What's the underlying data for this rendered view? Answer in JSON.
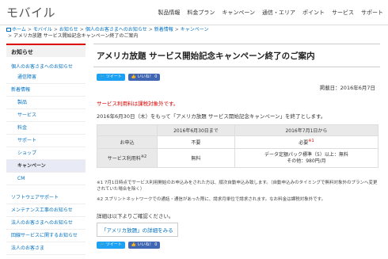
{
  "header": {
    "logo": "モバイル",
    "nav": [
      "製品情報",
      "料金プラン",
      "キャンペーン",
      "通信・エリア",
      "ポイント",
      "サービス",
      "サポート"
    ]
  },
  "breadcrumb": {
    "items": [
      "ホーム",
      "モバイル",
      "お知らせ",
      "個人のお客さまへのお知らせ",
      "新着情報",
      "キャンペーン"
    ],
    "current": "アメリカ放題 サービス開始記念キャンペーン終了のご案内"
  },
  "sidebar": {
    "heading": "お知らせ",
    "group": "個人のお客さまへのお知らせ",
    "items": [
      "通信障害",
      "新着情報",
      "製品",
      "サービス",
      "料金",
      "サポート",
      "ショップ",
      "キャンペーン",
      "CM"
    ],
    "bottom_links": [
      "ソフトウェアサポート",
      "メンテナンス工事のお知らせ",
      "法人のお客さまへのお知らせ",
      "回線サービスに関するお知らせ",
      "法人のお客さま"
    ]
  },
  "article": {
    "title": "アメリカ放題 サービス開始記念キャンペーン終了のご案内",
    "tweet_label": "ツイート",
    "like_label": "いいね！ 0",
    "pubdate": "掲載日：2016年6月7日",
    "notice_red": "サービス利用料は課税対象外です。",
    "lead": "2016年6月30日（木）をもって「アメリカ放題 サービス開始記念キャンペーン」を終了とします。",
    "table": {
      "headers": [
        "2016年6月30日まで",
        "2016年7月1日から"
      ],
      "rows": [
        {
          "label": "お申込",
          "before": "不要",
          "after": "必要"
        },
        {
          "label": "サービス利用料",
          "before": "無料",
          "after": "データ定額パック標準（5）以上：無料\nその他：980円/月"
        }
      ]
    },
    "note1": "※1 7月1日時点でサービス利用開始のお申込みをされた方は、順次自動申込み致します。（自動申込みのタイミングで無料対象外のプランへ変更されていた場合を除く）",
    "note2": "※2 スプリントネットワークでの通話・通信があった際に、請求月単位で請求されます。なお料金は課税対象外です。",
    "detail": "詳細は以下よりご確認ください。",
    "link": "「アメリカ放題」の詳細をみる"
  }
}
